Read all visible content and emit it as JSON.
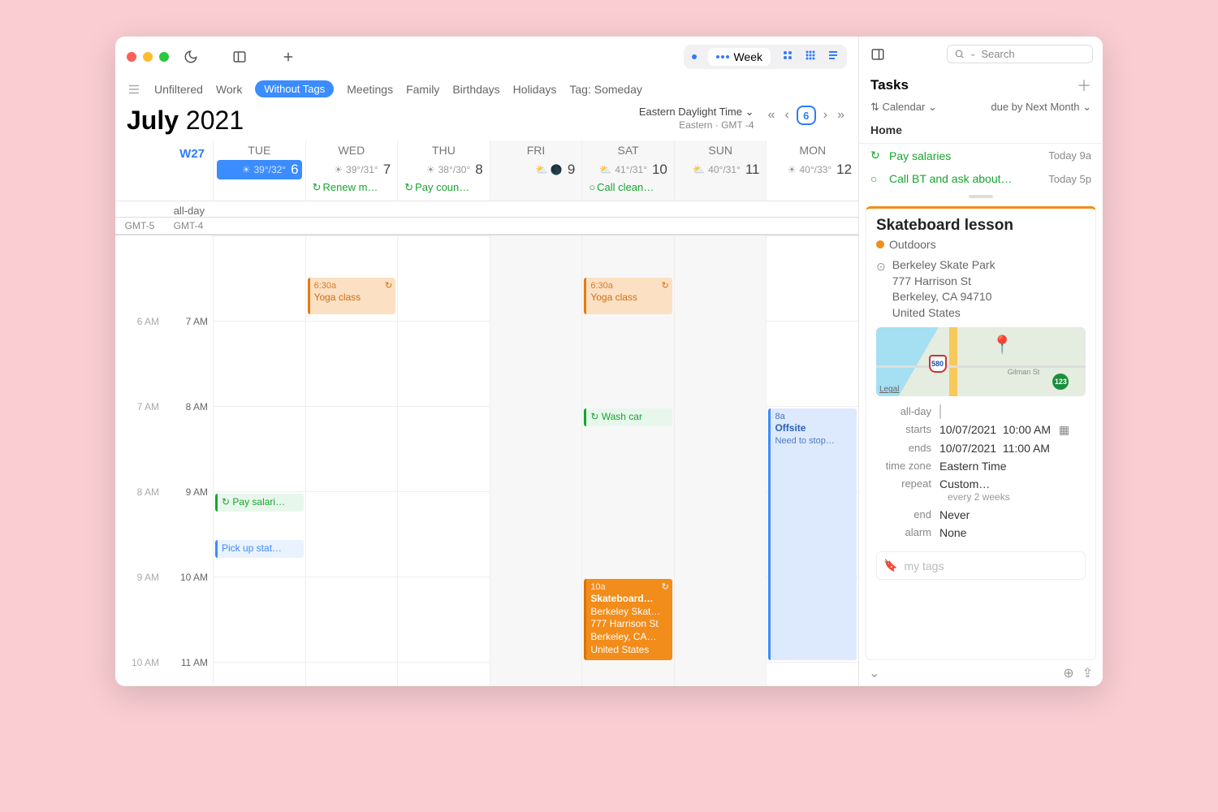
{
  "toolbar": {
    "view_label": "Week",
    "today_num": "6"
  },
  "filters": {
    "items": [
      "Unfiltered",
      "Work",
      "Without Tags",
      "Meetings",
      "Family",
      "Birthdays",
      "Holidays",
      "Tag: Someday"
    ],
    "active_index": 2
  },
  "header": {
    "month": "July",
    "year": "2021",
    "tz_line1": "Eastern Daylight Time",
    "tz_line2": "Eastern · GMT -4"
  },
  "week_label": "W27",
  "gutter_left": "GMT-5",
  "gutter_right": "GMT-4",
  "allday_label": "all-day",
  "days": [
    {
      "name": "TUE",
      "num": "6",
      "weather": "39°/32°",
      "selected": true
    },
    {
      "name": "WED",
      "num": "7",
      "weather": "39°/31°",
      "allday": "Renew m…"
    },
    {
      "name": "THU",
      "num": "8",
      "weather": "38°/30°",
      "allday": "Pay coun…"
    },
    {
      "name": "FRI",
      "num": "9",
      "weather": "",
      "dim": true
    },
    {
      "name": "SAT",
      "num": "10",
      "weather": "41°/31°",
      "allday": "Call clean…",
      "dim": true
    },
    {
      "name": "SUN",
      "num": "11",
      "weather": "40°/31°",
      "dim": true
    },
    {
      "name": "MON",
      "num": "12",
      "weather": "40°/33°"
    }
  ],
  "hours_left": [
    "",
    "6 AM",
    "7 AM",
    "8 AM",
    "9 AM",
    "10 AM"
  ],
  "hours_right": [
    "",
    "7 AM",
    "8 AM",
    "9 AM",
    "10 AM",
    "11 AM"
  ],
  "events": {
    "yoga1": {
      "time": "6:30a",
      "title": "Yoga class"
    },
    "yoga2": {
      "time": "6:30a",
      "title": "Yoga class"
    },
    "wash": {
      "title": "↻ Wash car"
    },
    "pay": {
      "title": "↻ Pay salari…"
    },
    "pickup": {
      "title": "Pick up stat…"
    },
    "offsite": {
      "time": "8a",
      "title": "Offsite",
      "sub": "Need to stop…"
    },
    "skate": {
      "time": "10a",
      "title": "Skateboard…",
      "l1": "Berkeley Skat…",
      "l2": "777 Harrison St",
      "l3": "Berkeley, CA…",
      "l4": "United States"
    }
  },
  "sidebar": {
    "search_placeholder": "Search",
    "tasks_title": "Tasks",
    "sort_left": "Calendar",
    "sort_right": "due by Next Month",
    "group": "Home",
    "tasks": [
      {
        "icon": "↻",
        "text": "Pay salaries",
        "due": "Today 9a"
      },
      {
        "icon": "○",
        "text": "Call BT and ask about…",
        "due": "Today 5p"
      }
    ],
    "detail": {
      "title": "Skateboard lesson",
      "calendar": "Outdoors",
      "address": [
        "Berkeley Skate Park",
        "777 Harrison St",
        "Berkeley, CA  94710",
        "United States"
      ],
      "map": {
        "legal": "Legal",
        "shield1": "580",
        "shield2": "123",
        "street": "Gilman St"
      },
      "allday_label": "all-day",
      "starts_label": "starts",
      "starts_date": "10/07/2021",
      "starts_time": "10:00 AM",
      "ends_label": "ends",
      "ends_date": "10/07/2021",
      "ends_time": "11:00 AM",
      "tz_label": "time zone",
      "tz_value": "Eastern Time",
      "repeat_label": "repeat",
      "repeat_value": "Custom…",
      "repeat_sub": "every 2 weeks",
      "end_label": "end",
      "end_value": "Never",
      "alarm_label": "alarm",
      "alarm_value": "None",
      "tags_placeholder": "my tags"
    }
  }
}
